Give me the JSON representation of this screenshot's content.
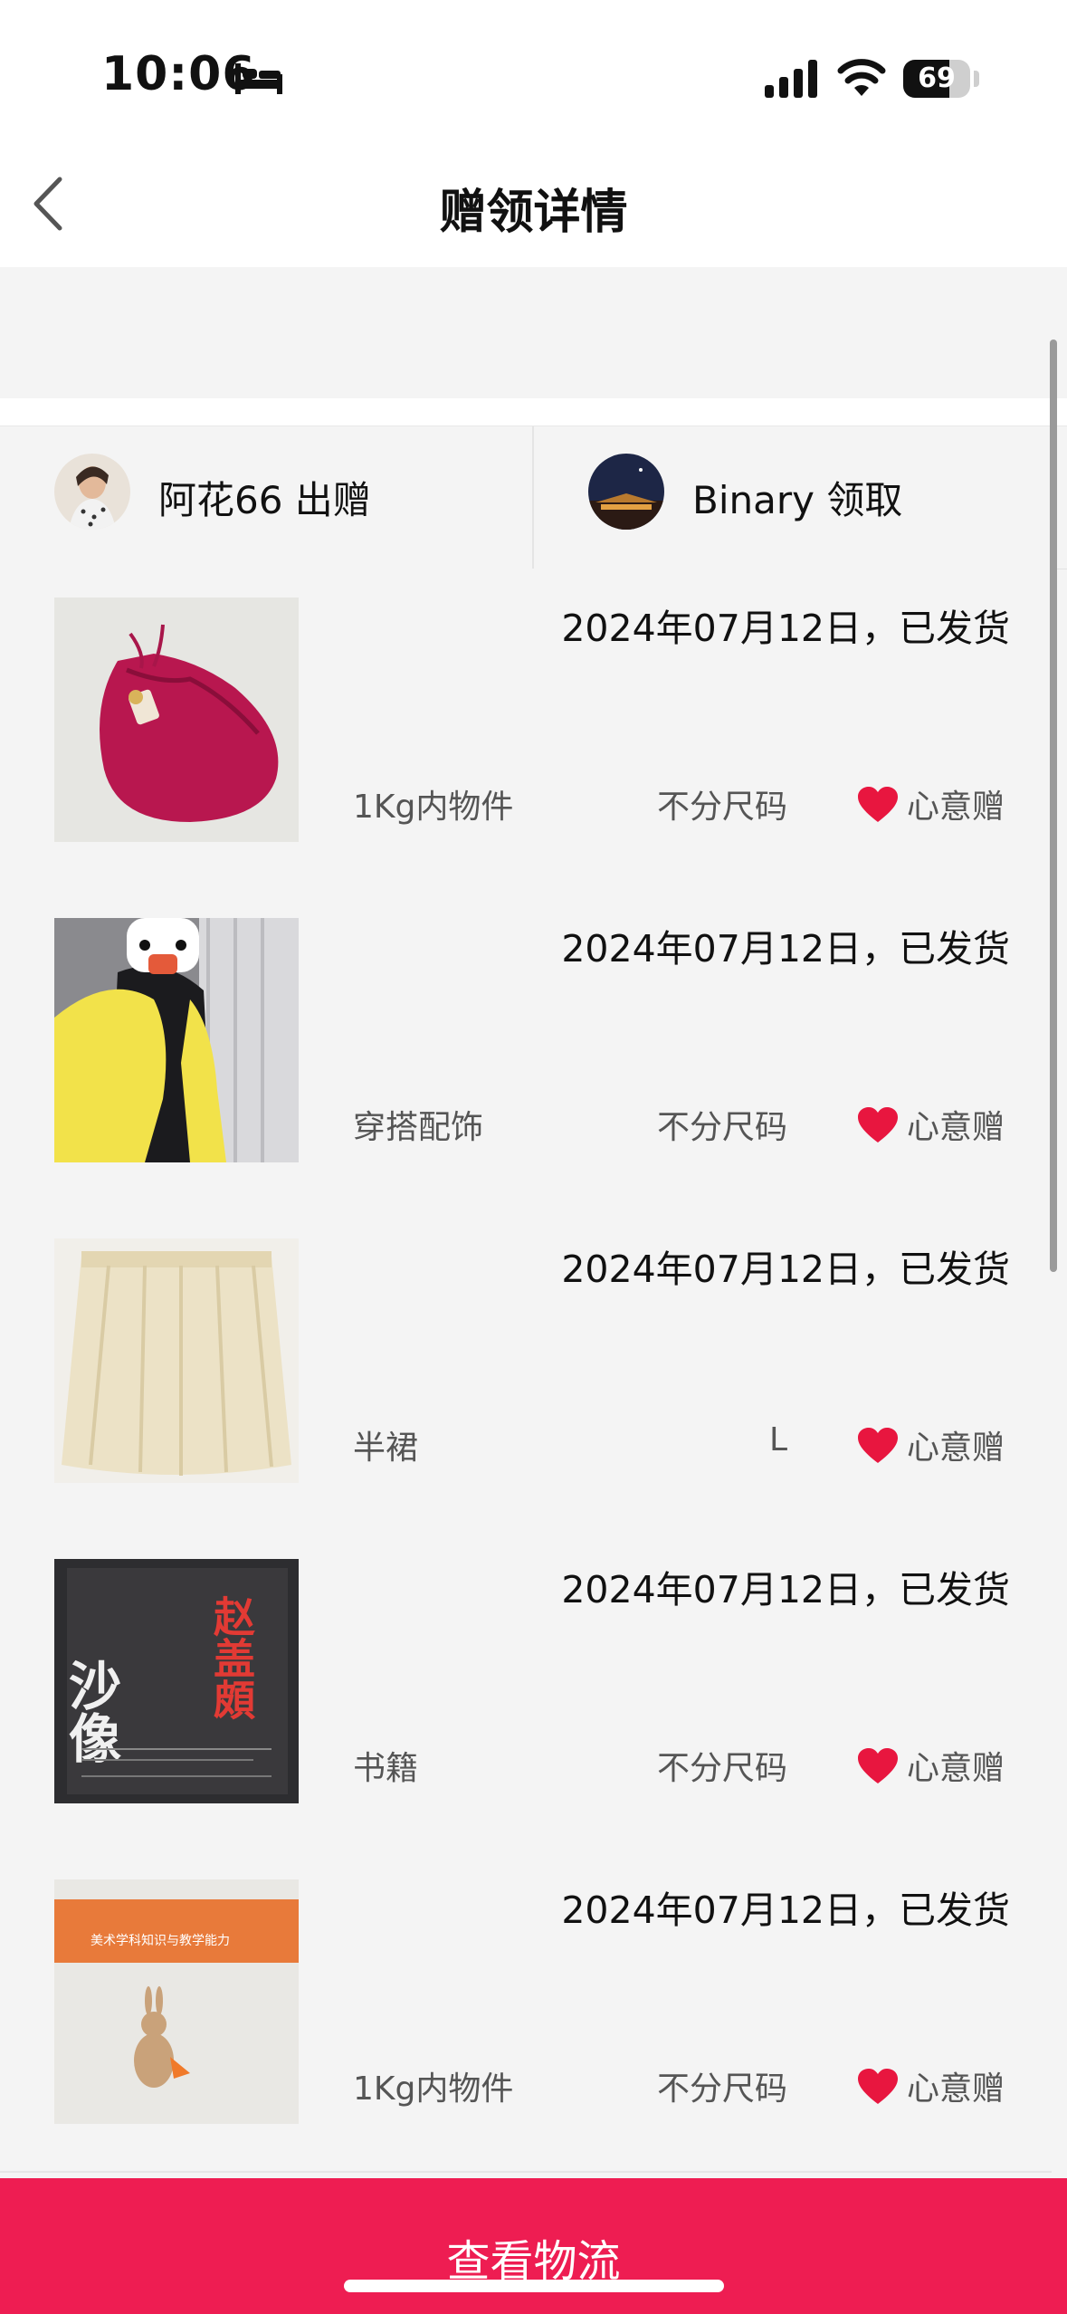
{
  "status_bar": {
    "time": "10:06",
    "battery": "69",
    "battery_level": 0.69
  },
  "nav": {
    "title": "赠领详情",
    "back_icon": "chevron-left-icon"
  },
  "parties": {
    "giver": {
      "name": "阿花66 出赠"
    },
    "receiver": {
      "name": "Binary 领取"
    }
  },
  "items": [
    {
      "date": "2024年07月12日，已发货",
      "category": "1Kg内物件",
      "size": "不分尺码",
      "gift_type": "心意赠"
    },
    {
      "date": "2024年07月12日，已发货",
      "category": "穿搭配饰",
      "size": "不分尺码",
      "gift_type": "心意赠"
    },
    {
      "date": "2024年07月12日，已发货",
      "category": "半裙",
      "size": "L",
      "gift_type": "心意赠"
    },
    {
      "date": "2024年07月12日，已发货",
      "category": "书籍",
      "size": "不分尺码",
      "gift_type": "心意赠"
    },
    {
      "date": "2024年07月12日，已发货",
      "category": "1Kg内物件",
      "size": "不分尺码",
      "gift_type": "心意赠"
    }
  ],
  "book_cover_text": {
    "title_left": "沙像",
    "title_right": "赵盖頗",
    "banner": "美术学科知识与教学能力"
  },
  "bottom_button": {
    "label": "查看物流"
  },
  "colors": {
    "accent": "#ee1d52",
    "heart": "#e8163f",
    "background": "#f4f4f4"
  }
}
